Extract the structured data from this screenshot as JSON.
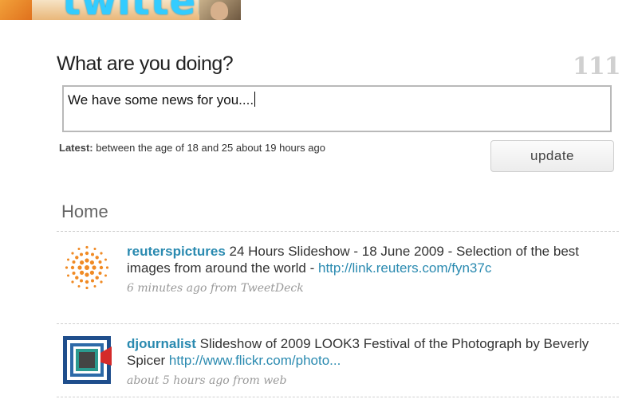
{
  "brand": {
    "logo_text": "twitter"
  },
  "composer": {
    "prompt": "What are you doing?",
    "char_count": "111",
    "status_text": "We have some news for you....",
    "latest_label": "Latest:",
    "latest_text": " between the age of 18 and 25 about 19 hours ago",
    "update_label": "update"
  },
  "timeline": {
    "title": "Home",
    "tweets": [
      {
        "user": "reuterspictures",
        "text": " 24 Hours Slideshow - 18 June 2009 - Selection of the best images from around the world - ",
        "link": "http://link.reuters.com/fyn37c",
        "meta": "6 minutes ago from TweetDeck",
        "avatar_icon": "reuters-logo-icon",
        "avatar_color": "#f08a24"
      },
      {
        "user": "djournalist",
        "text": " Slideshow of 2009 LOOK3 Festival of the Photograph by Beverly Spicer ",
        "link": "http://www.flickr.com/photo...",
        "meta": "about 5 hours ago from web",
        "avatar_icon": "djournalist-logo-icon",
        "avatar_color": "#1f4e8c"
      }
    ]
  },
  "colors": {
    "link": "#2a8ab0",
    "counter": "#d0d0d0",
    "meta": "#999999"
  }
}
